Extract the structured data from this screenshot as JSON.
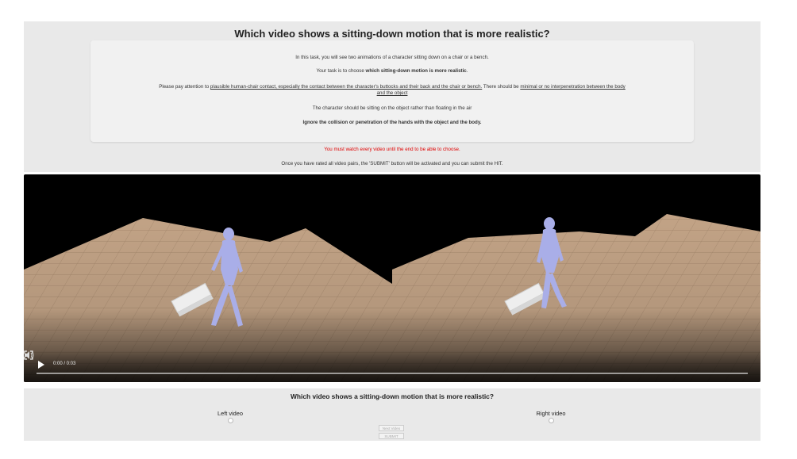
{
  "page": {
    "title": "Which video shows a sitting-down motion that is more realistic?",
    "instructions": {
      "line1": "In this task, you will see two animations of a character sitting down on a chair or a bench.",
      "line2_prefix": "Your task is to choose ",
      "line2_bold": "which sitting-down motion is more realistic",
      "line2_suffix": ".",
      "line3_prefix": "Please pay attention to ",
      "line3_u1": "plausible human-chair contact, especially the contact between the character's buttocks and their back and the chair or bench.",
      "line3_mid": " There should be ",
      "line3_u2": "minimal or no interpenetration between the body",
      "line3b_u": "and the object",
      "line4": "The character should be sitting on the object rather than floating in the air",
      "line5": "Ignore the collision or penetration of the hands with the object and the body."
    },
    "warning": "You must watch every video until the end to be able to choose.",
    "note": "Once you have rated all video pairs, the 'SUBMIT' button will be activated and you can submit the HIT."
  },
  "video": {
    "time": "0:00 / 0:03",
    "play_icon": "play-icon",
    "volume_icon": "volume-icon",
    "fullscreen_icon": "fullscreen-icon",
    "progress": 0
  },
  "question": {
    "text": "Which video shows a sitting-down motion that is more realistic?",
    "left_label": "Left video",
    "right_label": "Right video",
    "next_button": "Next Video",
    "submit_button": "SUBMIT"
  },
  "colors": {
    "panel_bg": "#e9e9e9",
    "warning": "#e00000",
    "floor": "#c9a98a",
    "character": "#a9aee8"
  }
}
